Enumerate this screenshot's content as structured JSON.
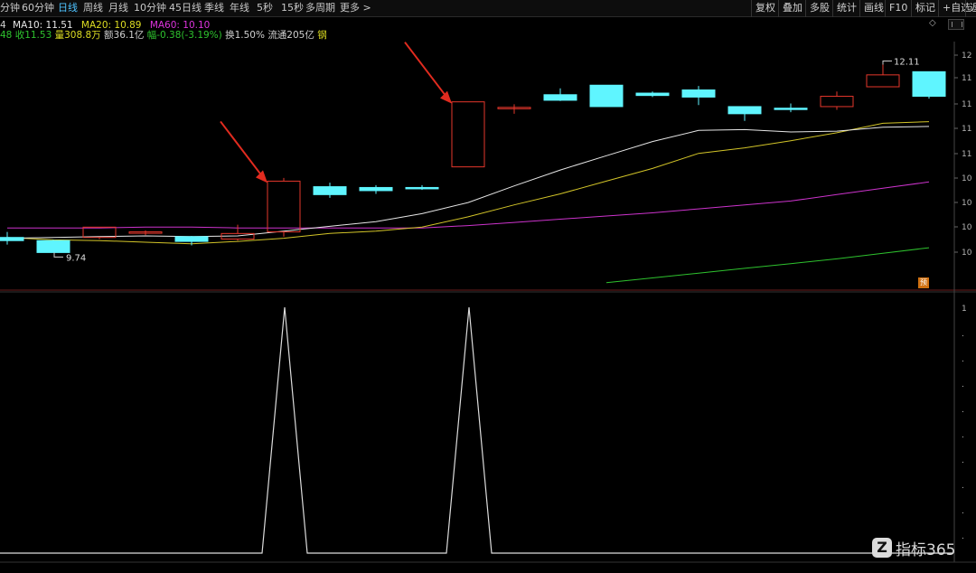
{
  "toolbar": {
    "periods": [
      "分钟",
      "60分钟",
      "日线",
      "周线",
      "月线",
      "10分钟",
      "45日线",
      "季线",
      "年线",
      "5秒",
      "15秒",
      "多周期",
      "更多 >"
    ],
    "active_period": "日线",
    "tools": [
      "复权",
      "叠加",
      "多股",
      "统计",
      "画线",
      "F10",
      "标记",
      "+自选",
      "返"
    ]
  },
  "infoline": {
    "row_prefix": "4",
    "ma5_label": "MA10: 11.51",
    "ma20_label": "MA20: 10.89",
    "ma60_label": "MA60: 10.10",
    "close": "48 收11.53",
    "volume": "量308.8万",
    "amount": "额36.1亿",
    "change": "幅-0.38(-3.19%)",
    "turnover": "换1.50%",
    "float": "流通205亿",
    "tag": "钢"
  },
  "annotations": {
    "high_price": "12.11",
    "low_price": "9.74"
  },
  "y_axis_ticks": [
    "12",
    "11",
    "11",
    "11",
    "11",
    "10",
    "10",
    "10",
    "10"
  ],
  "indicator_ticks": [
    "1",
    ".",
    ".",
    ".",
    ".",
    ".",
    ".",
    ".",
    ".",
    "."
  ],
  "watermark": {
    "logo": "Z",
    "text": "指标365"
  },
  "badge": "预",
  "colors": {
    "up": "#e5372b",
    "down": "#5ff5ff",
    "ma10": "#e6e6e6",
    "ma20": "#d2c428",
    "ma60": "#cc33cc",
    "ma120": "#2ec22e",
    "indicator": "#dcdcdc",
    "arrow": "#e12b1f"
  },
  "chart_data": {
    "type": "candlestick",
    "candles": [
      {
        "open": 9.93,
        "close": 9.89,
        "high": 10.0,
        "low": 9.84
      },
      {
        "open": 9.89,
        "close": 9.74,
        "high": 9.9,
        "low": 9.74
      },
      {
        "open": 9.93,
        "close": 10.06,
        "high": 10.06,
        "low": 9.91
      },
      {
        "open": 10.0,
        "close": 10.0,
        "high": 10.02,
        "low": 9.96
      },
      {
        "open": 9.94,
        "close": 9.88,
        "high": 9.95,
        "low": 9.83
      },
      {
        "open": 9.91,
        "close": 9.98,
        "high": 10.09,
        "low": 9.89
      },
      {
        "open": 10.0,
        "close": 10.64,
        "high": 10.68,
        "low": 9.94
      },
      {
        "open": 10.57,
        "close": 10.47,
        "high": 10.62,
        "low": 10.43
      },
      {
        "open": 10.56,
        "close": 10.52,
        "high": 10.59,
        "low": 10.48
      },
      {
        "open": 10.56,
        "close": 10.55,
        "high": 10.59,
        "low": 10.53
      },
      {
        "open": 10.82,
        "close": 11.64,
        "high": 11.64,
        "low": 10.82
      },
      {
        "open": 11.57,
        "close": 11.57,
        "high": 11.61,
        "low": 11.49
      },
      {
        "open": 11.73,
        "close": 11.66,
        "high": 11.81,
        "low": 11.65
      },
      {
        "open": 11.85,
        "close": 11.58,
        "high": 11.85,
        "low": 11.58
      },
      {
        "open": 11.75,
        "close": 11.72,
        "high": 11.77,
        "low": 11.7
      },
      {
        "open": 11.79,
        "close": 11.7,
        "high": 11.84,
        "low": 11.6
      },
      {
        "open": 11.58,
        "close": 11.49,
        "high": 11.58,
        "low": 11.4
      },
      {
        "open": 11.56,
        "close": 11.55,
        "high": 11.62,
        "low": 11.51
      },
      {
        "open": 11.58,
        "close": 11.71,
        "high": 11.77,
        "low": 11.54
      },
      {
        "open": 11.83,
        "close": 11.98,
        "high": 12.11,
        "low": 11.83
      },
      {
        "open": 12.02,
        "close": 11.71,
        "high": 12.02,
        "low": 11.68
      }
    ],
    "ma10": [
      9.92,
      9.93,
      9.94,
      9.95,
      9.94,
      9.95,
      10.01,
      10.07,
      10.13,
      10.23,
      10.37,
      10.58,
      10.78,
      10.96,
      11.14,
      11.28,
      11.29,
      11.26,
      11.27,
      11.32,
      11.33
    ],
    "ma20": [
      9.93,
      9.9,
      9.89,
      9.87,
      9.85,
      9.88,
      9.92,
      9.98,
      10.01,
      10.06,
      10.19,
      10.34,
      10.48,
      10.64,
      10.8,
      10.99,
      11.06,
      11.15,
      11.25,
      11.37,
      11.39
    ],
    "ma60": [
      10.05,
      10.05,
      10.05,
      10.06,
      10.06,
      10.05,
      10.05,
      10.05,
      10.05,
      10.05,
      10.08,
      10.12,
      10.16,
      10.2,
      10.24,
      10.29,
      10.34,
      10.39,
      10.47,
      10.55,
      10.63
    ],
    "ma120": [
      null,
      null,
      null,
      null,
      null,
      null,
      null,
      null,
      null,
      null,
      null,
      null,
      null,
      9.36,
      9.42,
      9.48,
      9.54,
      9.6,
      9.66,
      9.73,
      9.8
    ],
    "indicator": [
      0,
      0,
      0,
      0,
      0,
      0,
      1,
      0,
      0,
      0,
      1,
      0,
      0,
      0,
      0,
      0,
      0,
      0,
      0,
      0,
      0
    ],
    "signals": [
      6,
      10
    ],
    "price_range": [
      9.3,
      12.4
    ]
  }
}
